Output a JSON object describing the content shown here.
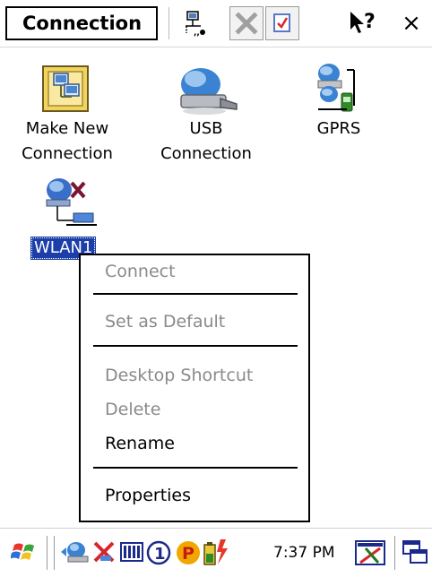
{
  "window": {
    "title": "Connection"
  },
  "toolbar": {
    "icons": [
      "network-properties-icon",
      "delete-icon",
      "checkbox-icon"
    ],
    "help": "?",
    "close": "×"
  },
  "desktop": {
    "items": [
      {
        "label": "Make New\nConnection",
        "icon": "make-new-connection-icon"
      },
      {
        "label": "USB\nConnection",
        "icon": "usb-connection-icon"
      },
      {
        "label": "GPRS",
        "icon": "gprs-icon"
      },
      {
        "label": "WLAN1",
        "icon": "wlan-icon",
        "selected": true
      }
    ]
  },
  "context_menu": {
    "items": [
      {
        "label": "Connect",
        "enabled": false
      },
      {
        "label": "Set as Default",
        "enabled": false
      },
      {
        "label": "Desktop Shortcut",
        "enabled": false
      },
      {
        "label": "Delete",
        "enabled": false
      },
      {
        "label": "Rename",
        "enabled": true
      },
      {
        "label": "Properties",
        "enabled": true
      }
    ]
  },
  "taskbar": {
    "clock": "7:37 PM",
    "tray_icons": [
      "start-flag-icon",
      "network-tray-icon",
      "wireless-x-icon",
      "battery-bars-icon",
      "circled-1-icon",
      "p-status-icon",
      "battery-charging-icon",
      "pen-x-icon",
      "windows-switch-icon"
    ]
  },
  "colors": {
    "selection": "#1c3ea8",
    "disabled_text": "#8a8a8a"
  }
}
